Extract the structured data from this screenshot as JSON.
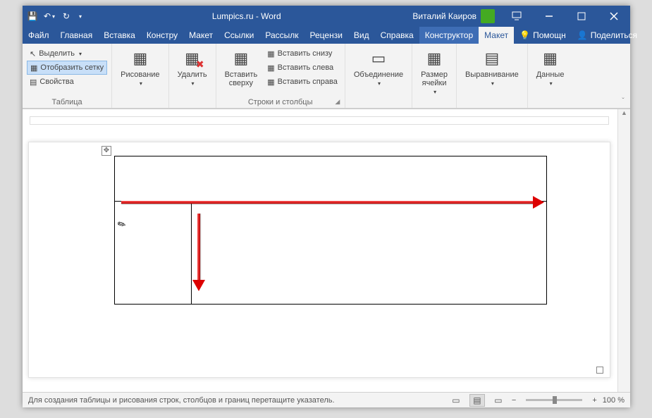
{
  "title": "Lumpics.ru  -  Word",
  "user": "Виталий Каиров",
  "menutabs": {
    "file": "Файл",
    "home": "Главная",
    "insert": "Вставка",
    "design": "Констру",
    "layout": "Макет",
    "refs": "Ссылки",
    "mail": "Рассылк",
    "review": "Рецензи",
    "view": "Вид",
    "help": "Справка",
    "tbl_design": "Конструктор",
    "tbl_layout": "Макет",
    "help2": "Помощн",
    "share": "Поделиться"
  },
  "ribbon": {
    "table": {
      "select": "Выделить",
      "grid": "Отобразить сетку",
      "props": "Свойства",
      "label": "Таблица"
    },
    "draw": {
      "draw": "Рисование"
    },
    "del": {
      "delete": "Удалить"
    },
    "rowscols": {
      "above": "Вставить\nсверху",
      "below": "Вставить снизу",
      "left": "Вставить слева",
      "right": "Вставить справа",
      "label": "Строки и столбцы"
    },
    "merge": {
      "label": "Объединение"
    },
    "size": {
      "label": "Размер\nячейки"
    },
    "align": {
      "label": "Выравнивание"
    },
    "data": {
      "label": "Данные"
    }
  },
  "status": {
    "msg": "Для создания таблицы и рисования строк, столбцов и границ перетащите указатель.",
    "zoom": "100 %"
  }
}
